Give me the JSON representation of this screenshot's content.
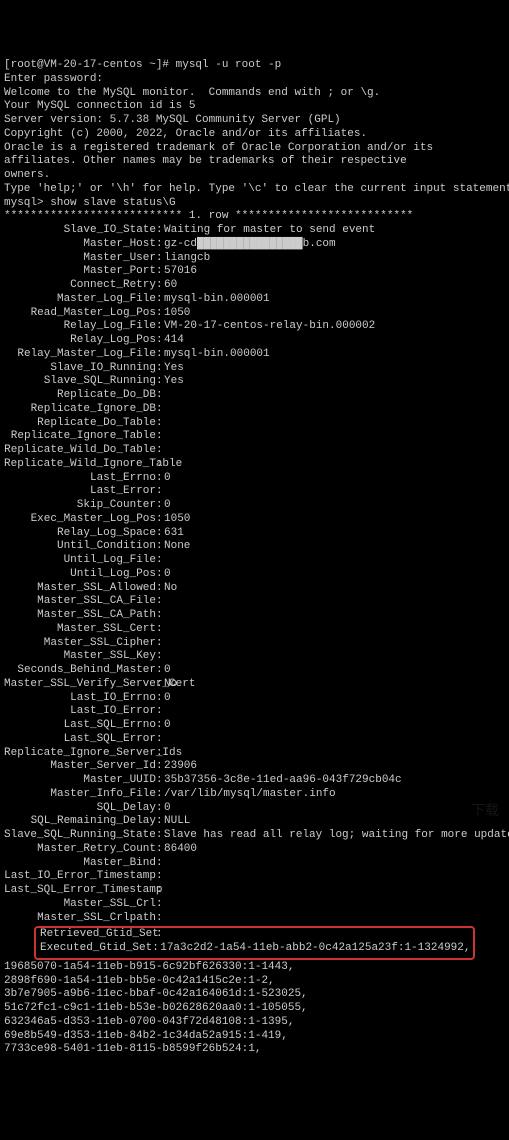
{
  "header": {
    "prompt": "[root@VM-20-17-centos ~]# mysql -u root -p",
    "enter_password": "Enter password:",
    "welcome": "Welcome to the MySQL monitor.  Commands end with ; or \\g.",
    "connection_id": "Your MySQL connection id is 5",
    "server_version": "Server version: 5.7.38 MySQL Community Server (GPL)",
    "copyright": "Copyright (c) 2000, 2022, Oracle and/or its affiliates.",
    "trademark1": "Oracle is a registered trademark of Oracle Corporation and/or its",
    "trademark2": "affiliates. Other names may be trademarks of their respective",
    "trademark3": "owners.",
    "help": "Type 'help;' or '\\h' for help. Type '\\c' to clear the current input statement."
  },
  "command": {
    "prompt": "mysql> show slave status\\G",
    "separator": "*************************** 1. row ***************************"
  },
  "status": [
    {
      "label": "Slave_IO_State",
      "value": "Waiting for master to send event"
    },
    {
      "label": "Master_Host",
      "value": "gz-cd████████████████b.com"
    },
    {
      "label": "Master_User",
      "value": "liangcb"
    },
    {
      "label": "Master_Port",
      "value": "57016"
    },
    {
      "label": "Connect_Retry",
      "value": "60"
    },
    {
      "label": "Master_Log_File",
      "value": "mysql-bin.000001"
    },
    {
      "label": "Read_Master_Log_Pos",
      "value": "1050"
    },
    {
      "label": "Relay_Log_File",
      "value": "VM-20-17-centos-relay-bin.000002"
    },
    {
      "label": "Relay_Log_Pos",
      "value": "414"
    },
    {
      "label": "Relay_Master_Log_File",
      "value": "mysql-bin.000001"
    },
    {
      "label": "Slave_IO_Running",
      "value": "Yes"
    },
    {
      "label": "Slave_SQL_Running",
      "value": "Yes"
    },
    {
      "label": "Replicate_Do_DB",
      "value": ""
    },
    {
      "label": "Replicate_Ignore_DB",
      "value": ""
    },
    {
      "label": "Replicate_Do_Table",
      "value": ""
    },
    {
      "label": "Replicate_Ignore_Table",
      "value": ""
    },
    {
      "label": "Replicate_Wild_Do_Table",
      "value": ""
    },
    {
      "label": "Replicate_Wild_Ignore_Table",
      "value": ""
    },
    {
      "label": "Last_Errno",
      "value": "0"
    },
    {
      "label": "Last_Error",
      "value": ""
    },
    {
      "label": "Skip_Counter",
      "value": "0"
    },
    {
      "label": "Exec_Master_Log_Pos",
      "value": "1050"
    },
    {
      "label": "Relay_Log_Space",
      "value": "631"
    },
    {
      "label": "Until_Condition",
      "value": "None"
    },
    {
      "label": "Until_Log_File",
      "value": ""
    },
    {
      "label": "Until_Log_Pos",
      "value": "0"
    },
    {
      "label": "Master_SSL_Allowed",
      "value": "No"
    },
    {
      "label": "Master_SSL_CA_File",
      "value": ""
    },
    {
      "label": "Master_SSL_CA_Path",
      "value": ""
    },
    {
      "label": "Master_SSL_Cert",
      "value": ""
    },
    {
      "label": "Master_SSL_Cipher",
      "value": ""
    },
    {
      "label": "Master_SSL_Key",
      "value": ""
    },
    {
      "label": "Seconds_Behind_Master",
      "value": "0"
    },
    {
      "label": "Master_SSL_Verify_Server_Cert",
      "value": "No"
    },
    {
      "label": "Last_IO_Errno",
      "value": "0"
    },
    {
      "label": "Last_IO_Error",
      "value": ""
    },
    {
      "label": "Last_SQL_Errno",
      "value": "0"
    },
    {
      "label": "Last_SQL_Error",
      "value": ""
    },
    {
      "label": "Replicate_Ignore_Server_Ids",
      "value": ""
    },
    {
      "label": "Master_Server_Id",
      "value": "23906"
    },
    {
      "label": "Master_UUID",
      "value": "35b37356-3c8e-11ed-aa96-043f729cb04c"
    },
    {
      "label": "Master_Info_File",
      "value": "/var/lib/mysql/master.info"
    },
    {
      "label": "SQL_Delay",
      "value": "0"
    },
    {
      "label": "SQL_Remaining_Delay",
      "value": "NULL"
    },
    {
      "label": "Slave_SQL_Running_State",
      "value": "Slave has read all relay log; waiting for more updates"
    },
    {
      "label": "Master_Retry_Count",
      "value": "86400"
    },
    {
      "label": "Master_Bind",
      "value": ""
    },
    {
      "label": "Last_IO_Error_Timestamp",
      "value": ""
    },
    {
      "label": "Last_SQL_Error_Timestamp",
      "value": ""
    },
    {
      "label": "Master_SSL_Crl",
      "value": ""
    },
    {
      "label": "Master_SSL_Crlpath",
      "value": ""
    }
  ],
  "highlighted": [
    {
      "label": "Retrieved_Gtid_Set",
      "value": ""
    },
    {
      "label": "Executed_Gtid_Set",
      "value": "17a3c2d2-1a54-11eb-abb2-0c42a125a23f:1-1324992,"
    }
  ],
  "footer": [
    "19685070-1a54-11eb-b915-6c92bf626330:1-1443,",
    "2898f690-1a54-11eb-bb5e-0c42a1415c2e:1-2,",
    "3b7e7905-a9b6-11ec-bbaf-0c42a164061d:1-523025,",
    "51c72fc1-c9c1-11eb-b53e-b02628620aa0:1-105055,",
    "632346a5-d353-11eb-0700-043f72d48108:1-1395,",
    "69e8b549-d353-11eb-84b2-1c34da52a915:1-419,",
    "7733ce98-5401-11eb-8115-b8599f26b524:1,"
  ]
}
